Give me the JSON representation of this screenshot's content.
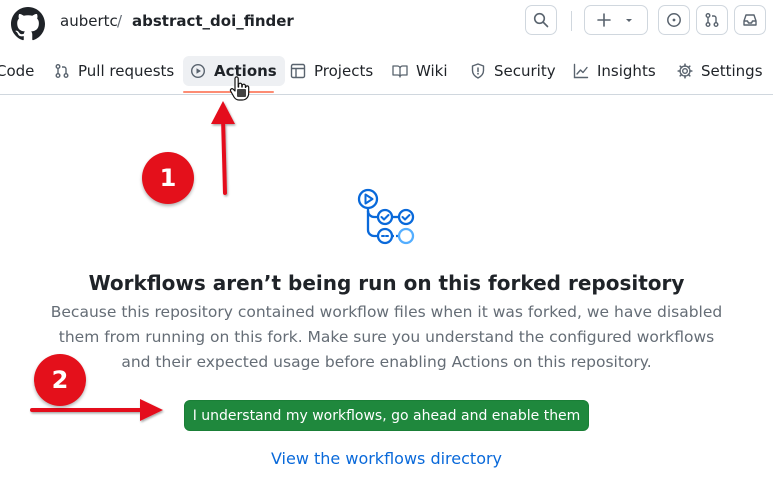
{
  "header": {
    "owner": "aubertc",
    "separator": "/",
    "repo": "abstract_doi_finder",
    "buttons": [
      {
        "name": "search-icon"
      },
      {
        "name": "plus-icon",
        "label": "+ ▾"
      },
      {
        "name": "issues-icon"
      },
      {
        "name": "pull-requests-icon"
      },
      {
        "name": "inbox-icon"
      }
    ]
  },
  "nav": {
    "tabs": [
      {
        "label": "Code",
        "icon": "code-icon"
      },
      {
        "label": "Pull requests",
        "icon": "pull-request-icon"
      },
      {
        "label": "Actions",
        "icon": "play-icon",
        "active": true
      },
      {
        "label": "Projects",
        "icon": "table-icon"
      },
      {
        "label": "Wiki",
        "icon": "book-icon"
      },
      {
        "label": "Security",
        "icon": "shield-icon"
      },
      {
        "label": "Insights",
        "icon": "graph-icon"
      },
      {
        "label": "Settings",
        "icon": "gear-icon"
      }
    ]
  },
  "blankslate": {
    "title": "Workflows aren’t being run on this forked repository",
    "description": "Because this repository contained workflow files when it was forked, we have disabled them from running on this fork. Make sure you understand the configured workflows and their expected usage before enabling Actions on this repository.",
    "enable_button": "I understand my workflows, go ahead and enable them",
    "directory_link": "View the workflows directory"
  },
  "annotations": {
    "badge_1": "1",
    "badge_2": "2"
  },
  "colors": {
    "primary_button": "#1f883d",
    "link": "#0969da",
    "annotation_red": "#e4101b",
    "active_tab_underline": "#fd8c73"
  }
}
